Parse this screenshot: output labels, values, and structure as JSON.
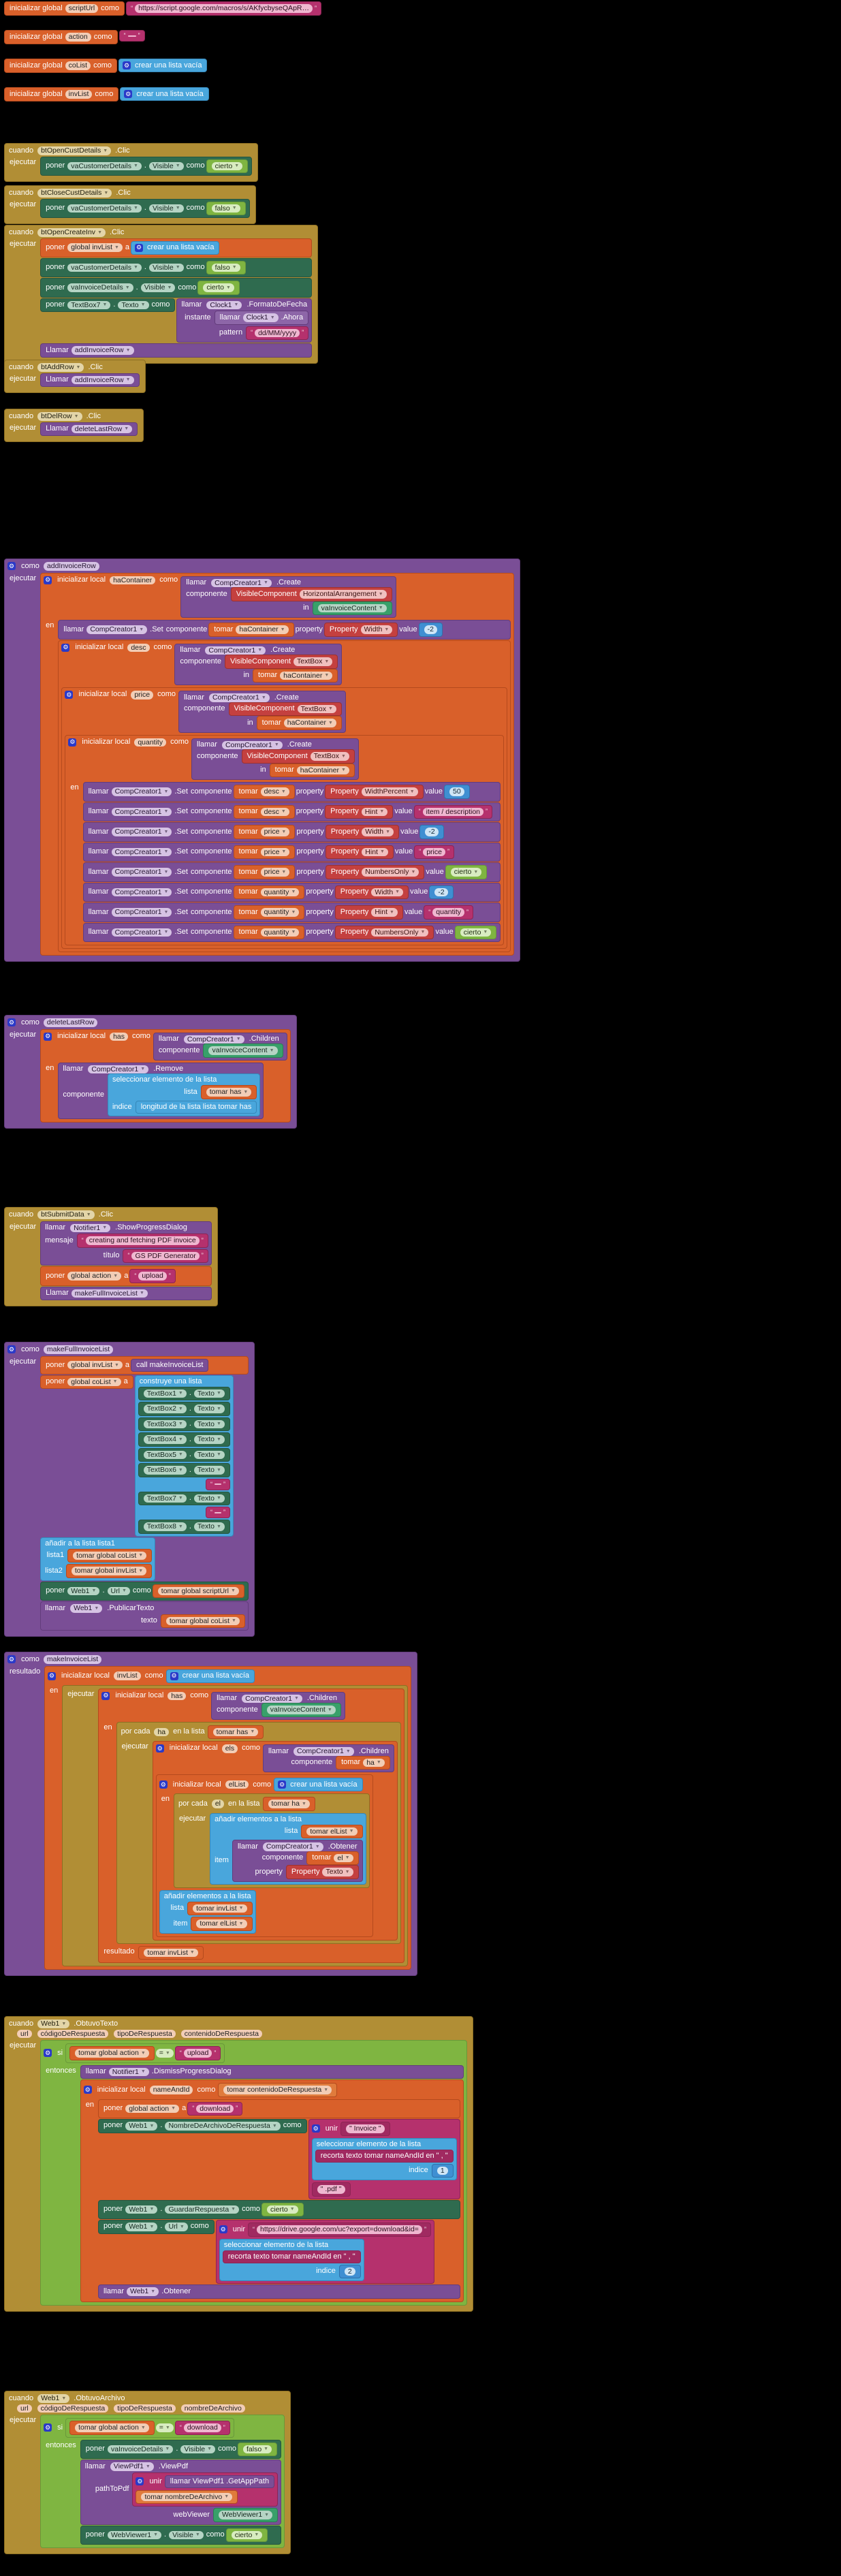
{
  "app": {
    "editor": "MIT App Inventor Blocks Editor",
    "language": "es",
    "background": "#000000"
  },
  "keywords": {
    "init_global": "inicializar global",
    "init_local": "inicializar local",
    "as": "como",
    "to": "a",
    "when": "cuando",
    "do": "ejecutar",
    "set": "poner",
    "call": "llamar",
    "get": "tomar",
    "in": "en",
    "if": "si",
    "then": "entonces",
    "result": "resultado",
    "to_proc": "como",
    "for_each": "por cada",
    "in_list": "en la lista",
    "item": "item",
    "index": "indice",
    "list": "lista",
    "value": "value",
    "property": "property",
    "component": "componente",
    "in_en": "in"
  },
  "globals": [
    {
      "name": "scriptUrl",
      "value_type": "text",
      "value": "https://script.google.com/macros/s/AKfycbyseQApR…"
    },
    {
      "name": "action",
      "value_type": "text",
      "value": ""
    },
    {
      "name": "coList",
      "value_type": "list",
      "value": "crear una lista vacía"
    },
    {
      "name": "invList",
      "value_type": "list",
      "value": "crear una lista vacía"
    }
  ],
  "events": [
    {
      "id": "btOpenCustDetails-click",
      "component": "btOpenCustDetails",
      "event": ".Clic",
      "statements": [
        {
          "kind": "set",
          "target": "vaCustomerDetails",
          "prop": "Visible",
          "value": "cierto",
          "value_kind": "logic"
        }
      ]
    },
    {
      "id": "btCloseCustDetails-click",
      "component": "btCloseCustDetails",
      "event": ".Clic",
      "statements": [
        {
          "kind": "set",
          "target": "vaCustomerDetails",
          "prop": "Visible",
          "value": "falso",
          "value_kind": "logic"
        }
      ]
    },
    {
      "id": "btOpenCreateInv-click",
      "component": "btOpenCreateInv",
      "event": ".Clic",
      "statements": [
        {
          "kind": "setglobal",
          "target": "global invList",
          "value": "crear una lista vacía",
          "value_kind": "list"
        },
        {
          "kind": "set",
          "target": "vaCustomerDetails",
          "prop": "Visible",
          "value": "falso",
          "value_kind": "logic"
        },
        {
          "kind": "set",
          "target": "vaInvoiceDetails",
          "prop": "Visible",
          "value": "cierto",
          "value_kind": "logic"
        },
        {
          "kind": "set-clock",
          "target": "TextBox7",
          "prop": "Texto",
          "call": "llamar",
          "clock": "Clock1",
          "method": ".FormatoDeFecha",
          "args": [
            {
              "name": "instante",
              "value": "llamar Clock1 .Ahora",
              "kind": "clockcall",
              "clock": "Clock1",
              "method": ".Ahora"
            },
            {
              "name": "pattern",
              "value": "dd/MM/yyyy",
              "kind": "text"
            }
          ]
        },
        {
          "kind": "callproc",
          "call": "Llamar",
          "name": "addInvoiceRow"
        }
      ]
    },
    {
      "id": "btAddRow-click",
      "component": "btAddRow",
      "event": ".Clic",
      "statements": [
        {
          "kind": "callproc",
          "call": "Llamar",
          "name": "addInvoiceRow"
        }
      ]
    },
    {
      "id": "btDelRow-click",
      "component": "btDelRow",
      "event": ".Clic",
      "statements": [
        {
          "kind": "callproc",
          "call": "Llamar",
          "name": "deleteLastRow"
        }
      ]
    },
    {
      "id": "btSubmitData-click",
      "component": "btSubmitData",
      "event": ".Clic",
      "statements": [
        {
          "kind": "call-notifier",
          "call": "llamar",
          "target": "Notifier1",
          "method": ".ShowProgressDialog",
          "args": [
            {
              "name": "mensaje",
              "value": "creating and fetching PDF invoice",
              "kind": "text"
            },
            {
              "name": "título",
              "value": "GS PDF Generator",
              "kind": "text"
            }
          ]
        },
        {
          "kind": "setglobal",
          "target": "global action",
          "value": "upload",
          "value_kind": "text"
        },
        {
          "kind": "callproc",
          "call": "Llamar",
          "name": "makeFullInvoiceList"
        }
      ]
    },
    {
      "id": "web1-gottext",
      "component": "Web1",
      "event": ".ObtuvoTexto",
      "params": [
        "url",
        "códigoDeRespuesta",
        "tipoDeRespuesta",
        "contenidoDeRespuesta"
      ],
      "statements": [
        {
          "kind": "if",
          "cond": "tomar global action = upload"
        }
      ]
    },
    {
      "id": "web1-gotfile",
      "component": "Web1",
      "event": ".ObtuvoArchivo",
      "params": [
        "url",
        "códigoDeRespuesta",
        "tipoDeRespuesta",
        "nombreDeArchivo"
      ],
      "statements": [
        {
          "kind": "if",
          "cond": "tomar global action = download"
        }
      ]
    }
  ],
  "procedures": [
    {
      "id": "addInvoiceRow",
      "header": "como",
      "name": "addInvoiceRow",
      "locals": [
        {
          "name": "haContainer",
          "create": "HorizontalArrangement",
          "in": "vaInvoiceContent"
        },
        {
          "name": "desc",
          "create": "TextBox",
          "in": "haContainer"
        },
        {
          "name": "price",
          "create": "TextBox",
          "in": "haContainer"
        },
        {
          "name": "quantity",
          "create": "TextBox",
          "in": "haContainer"
        }
      ],
      "set_calls": [
        {
          "component_get": "haContainer",
          "property": "Width",
          "value": "-2",
          "value_kind": "math"
        },
        {
          "component_get": "desc",
          "property": "WidthPercent",
          "value": "50",
          "value_kind": "math"
        },
        {
          "component_get": "desc",
          "property": "Hint",
          "value": "item / description",
          "value_kind": "text"
        },
        {
          "component_get": "price",
          "property": "Width",
          "value": "-2",
          "value_kind": "math"
        },
        {
          "component_get": "price",
          "property": "Hint",
          "value": "price",
          "value_kind": "text"
        },
        {
          "component_get": "price",
          "property": "NumbersOnly",
          "value": "cierto",
          "value_kind": "logic"
        },
        {
          "component_get": "quantity",
          "property": "Width",
          "value": "-2",
          "value_kind": "math"
        },
        {
          "component_get": "quantity",
          "property": "Hint",
          "value": "quantity",
          "value_kind": "text"
        },
        {
          "component_get": "quantity",
          "property": "NumbersOnly",
          "value": "cierto",
          "value_kind": "logic"
        }
      ]
    },
    {
      "id": "deleteLastRow",
      "header": "como",
      "name": "deleteLastRow",
      "local": {
        "name": "has",
        "call": "llamar",
        "target": "CompCreator1",
        "method": ".Children",
        "arg_name": "componente",
        "arg_value": "vaInvoiceContent"
      },
      "body": {
        "call": "llamar",
        "target": "CompCreator1",
        "method": ".Remove",
        "args": [
          {
            "name": "componente",
            "value": "seleccionar elemento de la lista",
            "sub": [
              {
                "name": "lista",
                "value": "tomar has"
              },
              {
                "name": "indice",
                "value": "longitud de la lista  lista  tomar has"
              }
            ]
          }
        ]
      }
    },
    {
      "id": "makeFullInvoiceList",
      "header": "como",
      "name": "makeFullInvoiceList",
      "statements": [
        {
          "kind": "setglobal",
          "target": "global invList",
          "to": "a",
          "value": "call makeInvoiceList",
          "value_kind": "proc"
        },
        {
          "kind": "setglobal",
          "target": "global coList",
          "to": "a",
          "value": "construye una lista",
          "value_kind": "list",
          "items": [
            "TextBox1 . Texto",
            "TextBox2 . Texto",
            "TextBox3 . Texto",
            "TextBox4 . Texto",
            "TextBox5 . Texto",
            "TextBox6 . Texto",
            "\" \"",
            "TextBox7 . Texto",
            "\" \"",
            "TextBox8 . Texto"
          ]
        },
        {
          "kind": "addlist",
          "label": "añadir a la lista lista1",
          "args": [
            {
              "name": "lista1",
              "value": "tomar global coList"
            },
            {
              "name": "lista2",
              "value": "tomar global invList"
            }
          ]
        },
        {
          "kind": "set",
          "target": "Web1",
          "prop": "Url",
          "value": "tomar global scriptUrl",
          "value_kind": "var"
        },
        {
          "kind": "call-web",
          "call": "llamar",
          "target": "Web1",
          "method": ".PublicarTexto",
          "args": [
            {
              "name": "texto",
              "value": "tomar global coList",
              "kind": "var"
            }
          ]
        }
      ]
    },
    {
      "id": "makeInvoiceList",
      "header": "como",
      "name": "makeInvoiceList",
      "result_label": "resultado",
      "locals": [
        {
          "name": "invList",
          "value": "crear una lista vacía"
        },
        {
          "name": "has",
          "value": "llamar CompCreator1 .Children  componente  vaInvoiceContent"
        },
        {
          "name": "elList",
          "value": "crear una lista vacía"
        }
      ],
      "loops": [
        {
          "label": "por cada",
          "var": "ha",
          "in": "tomar has"
        },
        {
          "label": "por cada",
          "var": "el",
          "in": "tomar ha"
        }
      ],
      "adds": [
        {
          "label": "añadir elementos a la lista",
          "args": [
            {
              "name": "lista",
              "value": "tomar elList"
            },
            {
              "name": "item",
              "value": "llamar CompCreator1 .Obtener  componente tomar el  property Property Texto"
            }
          ]
        },
        {
          "label": "añadir elementos a la lista",
          "args": [
            {
              "name": "lista",
              "value": "tomar invList"
            },
            {
              "name": "item",
              "value": "tomar elList"
            }
          ]
        }
      ],
      "result": "tomar invList"
    }
  ],
  "web_gottext": {
    "when": "cuando",
    "component": "Web1",
    "event": ".ObtuvoTexto",
    "params": [
      "url",
      "códigoDeRespuesta",
      "tipoDeRespuesta",
      "contenidoDeRespuesta"
    ],
    "do_label": "ejecutar",
    "if_label": "si",
    "cond_left": "tomar global action",
    "cond_op": "=",
    "cond_right": "upload",
    "then_label": "entonces",
    "then_call": {
      "call": "llamar",
      "target": "Notifier1",
      "method": ".DismissProgressDialog"
    },
    "local": {
      "name": "nameAndId",
      "value": "tomar contenidoDeRespuesta"
    },
    "in_label": "en",
    "statements": [
      {
        "kind": "setglobal",
        "target": "global action",
        "value": "download"
      },
      {
        "kind": "set",
        "target": "Web1",
        "prop": "NombreDeArchivoDeRespuesta",
        "value_kind": "join",
        "join": "unir",
        "parts": [
          "\" Invoice \"",
          "seleccionar elemento de la lista",
          "\" .pdf \""
        ],
        "select_list": "recorta  texto  tomar nameAndId  en  \" , \"",
        "select_index": "1"
      },
      {
        "kind": "set",
        "target": "Web1",
        "prop": "GuardarRespuesta",
        "value": "cierto",
        "value_kind": "logic"
      },
      {
        "kind": "set",
        "target": "Web1",
        "prop": "Url",
        "value_kind": "join",
        "join": "unir",
        "parts": [
          "https://drive.google.com/uc?export=download&id=",
          "seleccionar elemento de la lista"
        ],
        "select_list": "recorta  texto  tomar nameAndId  en  \" , \"",
        "select_index": "2"
      },
      {
        "kind": "call-web",
        "call": "llamar",
        "target": "Web1",
        "method": ".Obtener"
      }
    ]
  },
  "web_gotfile": {
    "when": "cuando",
    "component": "Web1",
    "event": ".ObtuvoArchivo",
    "params": [
      "url",
      "códigoDeRespuesta",
      "tipoDeRespuesta",
      "nombreDeArchivo"
    ],
    "do_label": "ejecutar",
    "if_label": "si",
    "cond_left": "tomar global action",
    "cond_op": "=",
    "cond_right": "download",
    "then_label": "entonces",
    "statements": [
      {
        "kind": "set",
        "target": "vaInvoiceDetails",
        "prop": "Visible",
        "value": "falso",
        "value_kind": "logic"
      },
      {
        "kind": "call",
        "call": "llamar",
        "target": "ViewPdf1",
        "method": ".ViewPdf",
        "args": [
          {
            "name": "pathToPdf",
            "value_kind": "join",
            "join": "unir",
            "parts": [
              "llamar ViewPdf1 .GetAppPath",
              "tomar nombreDeArchivo"
            ]
          },
          {
            "name": "webViewer",
            "value": "WebViewer1",
            "kind": "component"
          }
        ]
      },
      {
        "kind": "set",
        "target": "WebViewer1",
        "prop": "Visible",
        "value": "cierto",
        "value_kind": "logic"
      }
    ]
  }
}
